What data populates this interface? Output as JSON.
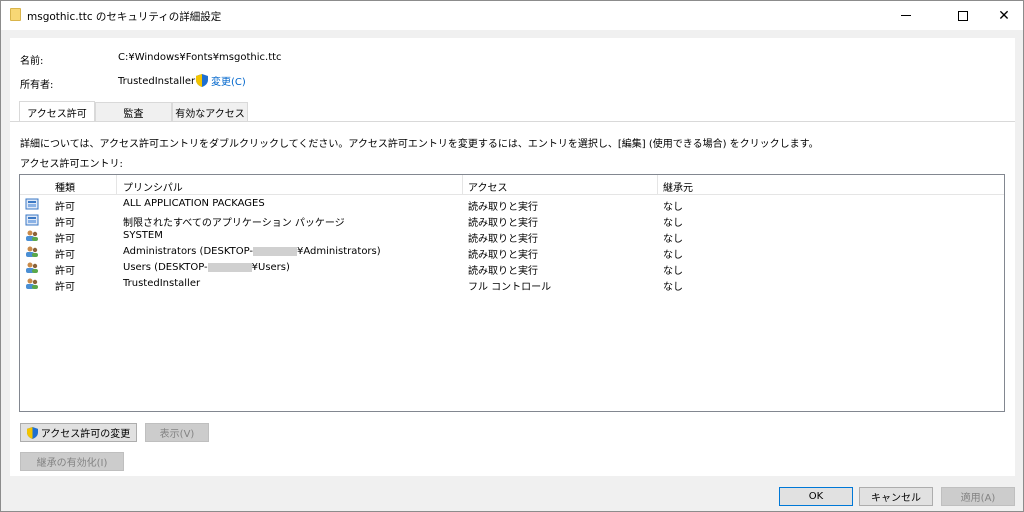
{
  "window": {
    "title": "msgothic.ttc のセキュリティの詳細設定"
  },
  "info": {
    "name_label": "名前:",
    "name_value": "C:¥Windows¥Fonts¥msgothic.ttc",
    "owner_label": "所有者:",
    "owner_value": "TrustedInstaller",
    "owner_change": "変更(C)"
  },
  "tabs": [
    {
      "label": "アクセス許可"
    },
    {
      "label": "監査"
    },
    {
      "label": "有効なアクセス"
    }
  ],
  "description": "詳細については、アクセス許可エントリをダブルクリックしてください。アクセス許可エントリを変更するには、エントリを選択し、[編集] (使用できる場合) をクリックします。",
  "entries_label": "アクセス許可エントリ:",
  "columns": {
    "type": "種類",
    "principal": "プリンシパル",
    "access": "アクセス",
    "inherited": "継承元"
  },
  "rows": [
    {
      "icon": "package-icon",
      "type": "許可",
      "principal_a": "ALL APPLICATION PACKAGES",
      "principal_b": "",
      "access": "読み取りと実行",
      "inherited": "なし"
    },
    {
      "icon": "package-icon",
      "type": "許可",
      "principal_a": "制限されたすべてのアプリケーション パッケージ",
      "principal_b": "",
      "access": "読み取りと実行",
      "inherited": "なし"
    },
    {
      "icon": "users-icon",
      "type": "許可",
      "principal_a": "SYSTEM",
      "principal_b": "",
      "access": "読み取りと実行",
      "inherited": "なし"
    },
    {
      "icon": "users-icon",
      "type": "許可",
      "principal_a": "Administrators (DESKTOP-",
      "principal_b": "¥Administrators)",
      "access": "読み取りと実行",
      "inherited": "なし"
    },
    {
      "icon": "users-icon",
      "type": "許可",
      "principal_a": "Users (DESKTOP-",
      "principal_b": "¥Users)",
      "access": "読み取りと実行",
      "inherited": "なし"
    },
    {
      "icon": "users-icon",
      "type": "許可",
      "principal_a": "TrustedInstaller",
      "principal_b": "",
      "access": "フル コントロール",
      "inherited": "なし"
    }
  ],
  "buttons": {
    "change_permissions": "アクセス許可の変更",
    "show": "表示(V)",
    "enable_inheritance": "継承の有効化(I)",
    "ok": "OK",
    "cancel": "キャンセル",
    "apply": "適用(A)"
  }
}
